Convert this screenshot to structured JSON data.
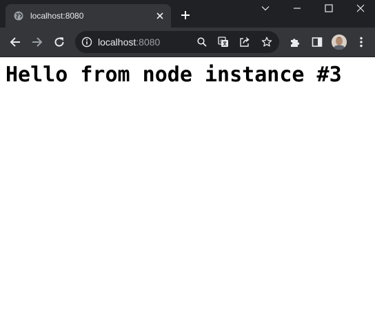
{
  "tab": {
    "title": "localhost:8080",
    "favicon_icon": "globe-icon"
  },
  "window_controls": [
    "chevron-down-icon",
    "minimize-icon",
    "maximize-icon",
    "close-icon"
  ],
  "toolbar": {
    "back_icon": "arrow-left-icon",
    "forward_icon": "arrow-right-icon",
    "reload_icon": "reload-icon"
  },
  "omnibox": {
    "host": "localhost",
    "port": ":8080",
    "icons": [
      "info-icon",
      "search-icon",
      "translate-icon",
      "share-icon",
      "star-icon"
    ]
  },
  "toolbar_right_icons": [
    "extensions-puzzle-icon",
    "side-panel-icon",
    "profile-avatar",
    "more-vertical-icon"
  ],
  "page": {
    "heading": "Hello from node instance #3"
  },
  "colors": {
    "titlebar_bg": "#202124",
    "toolbar_bg": "#35363a",
    "omnibox_bg": "#202124",
    "icon": "#e8eaed",
    "page_bg": "#ffffff",
    "text": "#000000"
  }
}
